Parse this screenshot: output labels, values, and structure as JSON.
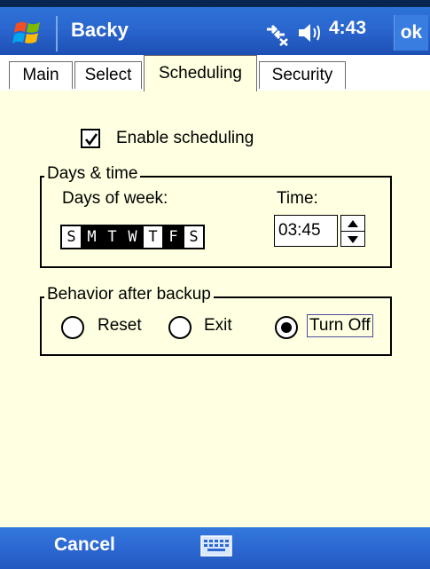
{
  "titlebar": {
    "app_title": "Backy",
    "clock": "4:43",
    "ok_label": "ok",
    "icons": [
      "windows-start-icon",
      "connectivity-icon",
      "volume-icon"
    ]
  },
  "tabs": [
    {
      "label": "Main",
      "active": false
    },
    {
      "label": "Select",
      "active": false
    },
    {
      "label": "Scheduling",
      "active": true
    },
    {
      "label": "Security",
      "active": false
    }
  ],
  "scheduling": {
    "enable_label": "Enable scheduling",
    "enable_checked": true,
    "days_group_label": "Days & time",
    "days_of_week_label": "Days of week:",
    "days": [
      {
        "letter": "S",
        "selected": false
      },
      {
        "letter": "M",
        "selected": true
      },
      {
        "letter": "T",
        "selected": true
      },
      {
        "letter": "W",
        "selected": true
      },
      {
        "letter": "T",
        "selected": false
      },
      {
        "letter": "F",
        "selected": true
      },
      {
        "letter": "S",
        "selected": false
      }
    ],
    "time_label": "Time:",
    "time_value": "03:45"
  },
  "behavior": {
    "group_label": "Behavior after backup",
    "options": [
      {
        "label": "Reset",
        "selected": false
      },
      {
        "label": "Exit",
        "selected": false
      },
      {
        "label": "Turn Off",
        "selected": true
      }
    ]
  },
  "bottombar": {
    "cancel_label": "Cancel",
    "keyboard_icon": "keyboard-icon"
  },
  "colors": {
    "titlebar": "#2a66cf",
    "content_bg": "#ffffe1",
    "bottombar": "#2c68d2"
  }
}
